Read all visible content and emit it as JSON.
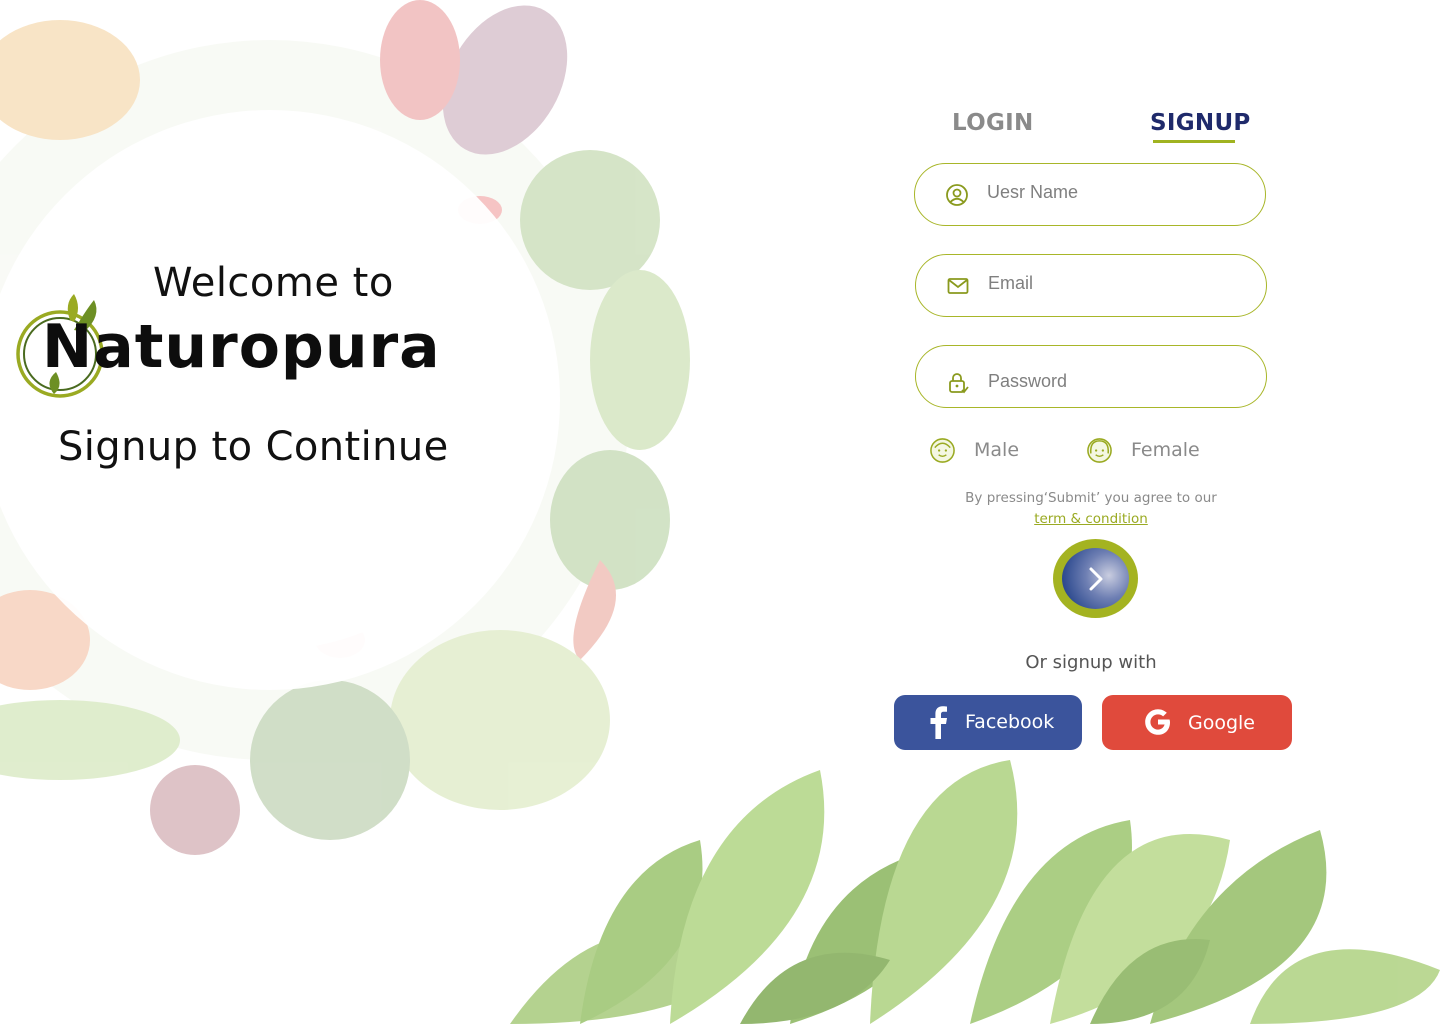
{
  "welcome": {
    "line1": "Welcome to",
    "brand": "Naturopura",
    "subtitle": "Signup to Continue"
  },
  "tabs": {
    "login": "LOGIN",
    "signup": "SIGNUP",
    "active": "signup"
  },
  "form": {
    "username_placeholder": "Uesr Name",
    "email_placeholder": "Email",
    "password_placeholder": "Password",
    "gender": {
      "male": "Male",
      "female": "Female"
    },
    "terms_prefix": "By pressing‘Submit’ you agree to our",
    "terms_link": "term & condition"
  },
  "social": {
    "heading": "Or signup with",
    "facebook": "Facebook",
    "google": "Google"
  },
  "colors": {
    "accent_green": "#a8b629",
    "tab_active": "#1f2a6b",
    "tab_inactive": "#8a8a8a",
    "facebook": "#3b549c",
    "google": "#e04a3c"
  },
  "icons": {
    "username": "user-circle-icon",
    "email": "envelope-icon",
    "password": "lock-icon",
    "male": "boy-face-icon",
    "female": "girl-face-icon",
    "submit": "chevron-right-icon",
    "facebook": "facebook-logo-icon",
    "google": "google-logo-icon"
  }
}
